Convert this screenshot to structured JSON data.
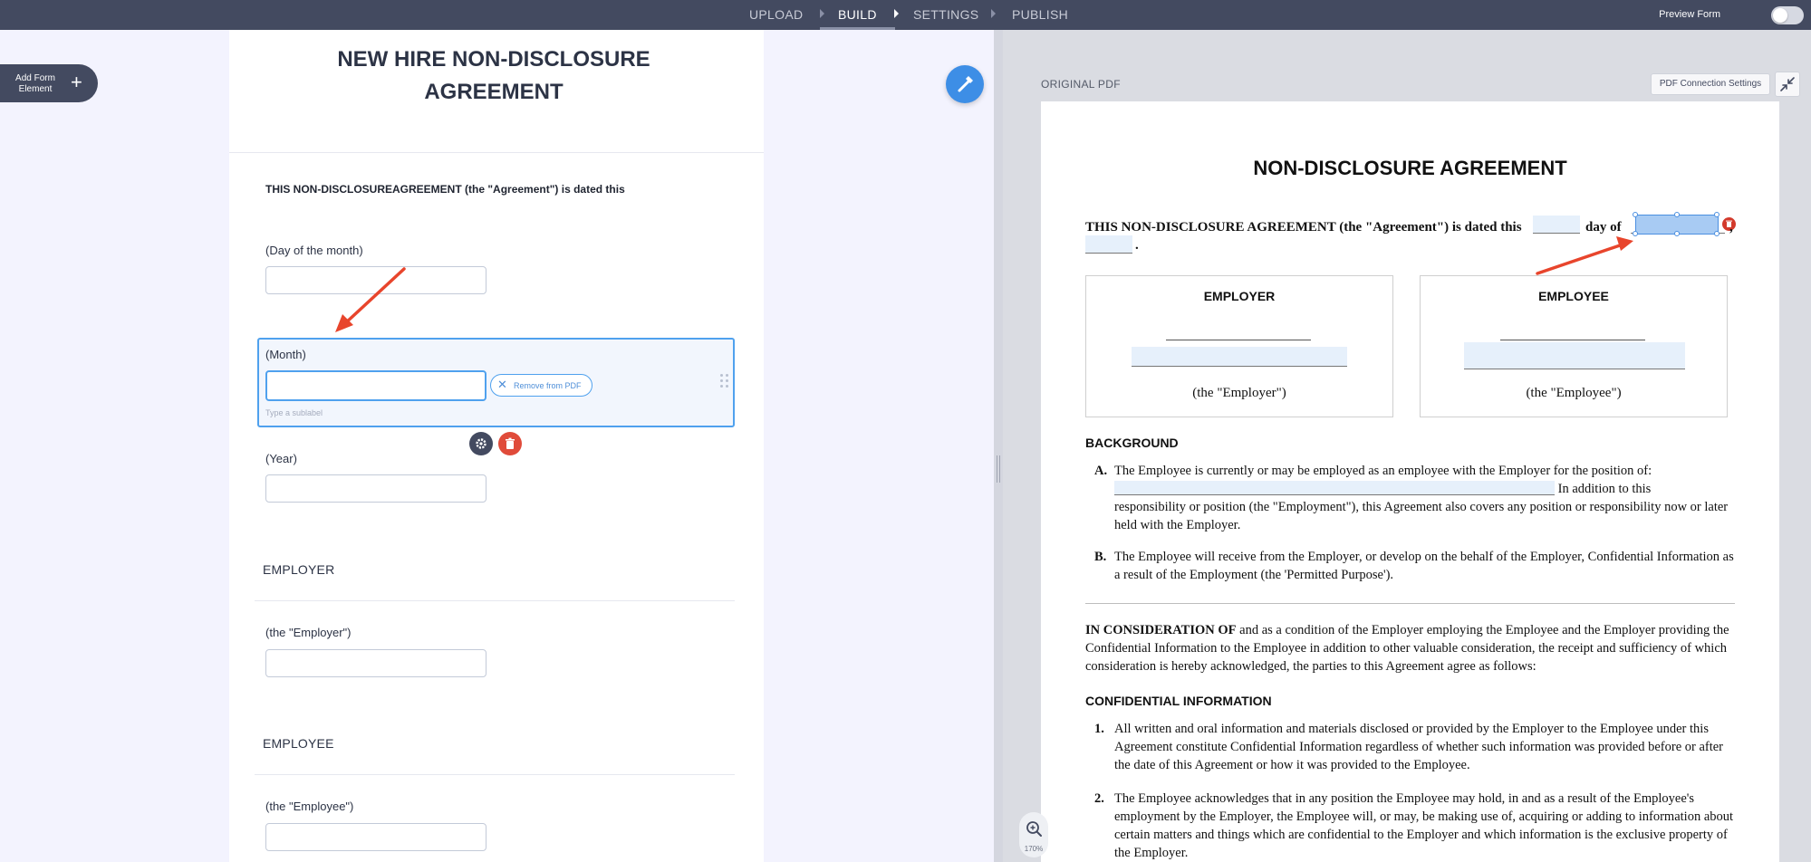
{
  "topbar": {
    "steps": [
      {
        "label": "UPLOAD"
      },
      {
        "label": "BUILD"
      },
      {
        "label": "SETTINGS"
      },
      {
        "label": "PUBLISH"
      }
    ],
    "active_step": "BUILD",
    "preview_label": "Preview Form",
    "preview_on": false
  },
  "sidebar": {
    "add_element_label": "Add Form Element"
  },
  "form": {
    "title": "NEW HIRE NON-DISCLOSURE AGREEMENT",
    "intro": "THIS NON-DISCLOSUREAGREEMENT (the \"Agreement\") is dated this",
    "fields": [
      {
        "label": "(Day of the month)",
        "value": ""
      },
      {
        "label": "(Month)",
        "value": "",
        "sublabel_placeholder": "Type a sublabel",
        "selected": true
      },
      {
        "label": "(Year)",
        "value": ""
      }
    ],
    "remove_from_pdf_label": "Remove from PDF",
    "sections": [
      {
        "heading": "EMPLOYER",
        "field_label": "(the \"Employer\")"
      },
      {
        "heading": "EMPLOYEE",
        "field_label": "(the \"Employee\")"
      }
    ]
  },
  "pdf_panel": {
    "label": "ORIGINAL PDF",
    "connection_button": "PDF Connection Settings",
    "zoom_level": "170%",
    "doc": {
      "title": "NON-DISCLOSURE AGREEMENT",
      "line1_a": "THIS NON-DISCLOSURE AGREEMENT (the \"Agreement\") is dated this",
      "line1_b": "day of",
      "line1_c": ",",
      "line2_end": ".",
      "employer_head": "EMPLOYER",
      "employer_sub": "(the \"Employer\")",
      "employee_head": "EMPLOYEE",
      "employee_sub": "(the \"Employee\")",
      "background_head": "BACKGROUND",
      "item_a_label": "A.",
      "item_a_1": "The Employee is currently or may be employed as an employee with the Employer for the position of:",
      "item_a_2": "In addition to this",
      "item_a_3": "responsibility or position (the \"Employment\"), this Agreement also covers any position or responsibility now or later held with the Employer.",
      "item_b_label": "B.",
      "item_b": "The Employee will receive from the Employer, or develop on the behalf of the Employer, Confidential Information as a result of the Employment (the 'Permitted Purpose').",
      "consideration_bold": "IN CONSIDERATION OF",
      "consideration_rest": "and as a condition of the Employer employing the Employee and the Employer providing the Confidential Information to the Employee in addition to other valuable consideration, the receipt and sufficiency of which consideration is hereby acknowledged, the parties to this Agreement agree as follows:",
      "confidential_head": "CONFIDENTIAL INFORMATION",
      "item_1_label": "1.",
      "item_1": "All written and oral information and materials disclosed or provided by the Employer to the Employee under this Agreement constitute Confidential Information regardless of whether such information was provided before or after the date of this Agreement or how it was provided to the Employee.",
      "item_2_label": "2.",
      "item_2": "The Employee acknowledges that in any position the Employee may hold, in and as a result of the Employee's employment by the Employer, the Employee will, or may, be making use of, acquiring or adding to information about certain matters and things which are confidential to the Employer and which information is the exclusive property of the Employer."
    }
  },
  "colors": {
    "topbar": "#434a60",
    "accent_blue": "#4fa1ee",
    "delete_red": "#e04b3a",
    "annotation_arrow": "#e8452c"
  },
  "icons": [
    "plus-icon",
    "wand-icon",
    "close-icon",
    "gear-icon",
    "trash-icon",
    "collapse-icon",
    "zoom-icon",
    "drag-handle-icon"
  ]
}
